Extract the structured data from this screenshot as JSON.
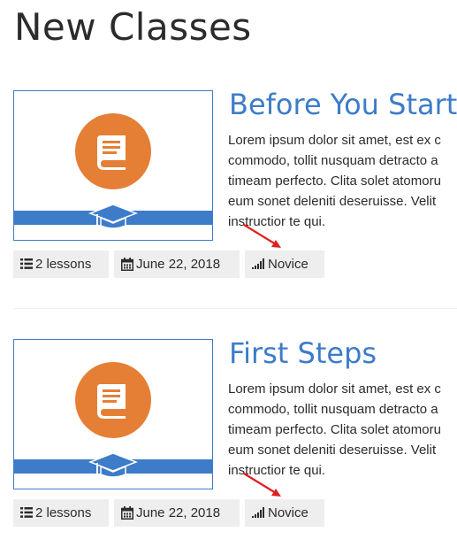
{
  "page": {
    "title": "New Classes"
  },
  "colors": {
    "accent_blue": "#3d7cc9",
    "thumbnail_orange": "#e57f35",
    "chip_background": "#eeeeee",
    "annotation_red": "#e0201f"
  },
  "courses": [
    {
      "title": "Before You Start",
      "excerpt_lines": [
        "Lorem ipsum dolor sit amet, est ex c",
        "commodo, tollit nusquam detracto a",
        "timeam perfecto. Clita solet atomoru",
        "eum sonet deleniti deseruisse. Velit",
        "instructior te qui."
      ],
      "thumbnail_icons": [
        "book-icon",
        "graduation-cap-icon"
      ],
      "meta": {
        "lessons": "2 lessons",
        "date": "June 22, 2018",
        "level": "Novice"
      },
      "meta_icons": [
        "list-icon",
        "calendar-icon",
        "signal-bars-icon"
      ]
    },
    {
      "title": "First Steps",
      "excerpt_lines": [
        "Lorem ipsum dolor sit amet, est ex c",
        "commodo, tollit nusquam detracto a",
        "timeam perfecto. Clita solet atomoru",
        "eum sonet deleniti deseruisse. Velit",
        "instructior te qui."
      ],
      "thumbnail_icons": [
        "book-icon",
        "graduation-cap-icon"
      ],
      "meta": {
        "lessons": "2 lessons",
        "date": "June 22, 2018",
        "level": "Novice"
      },
      "meta_icons": [
        "list-icon",
        "calendar-icon",
        "signal-bars-icon"
      ]
    }
  ]
}
